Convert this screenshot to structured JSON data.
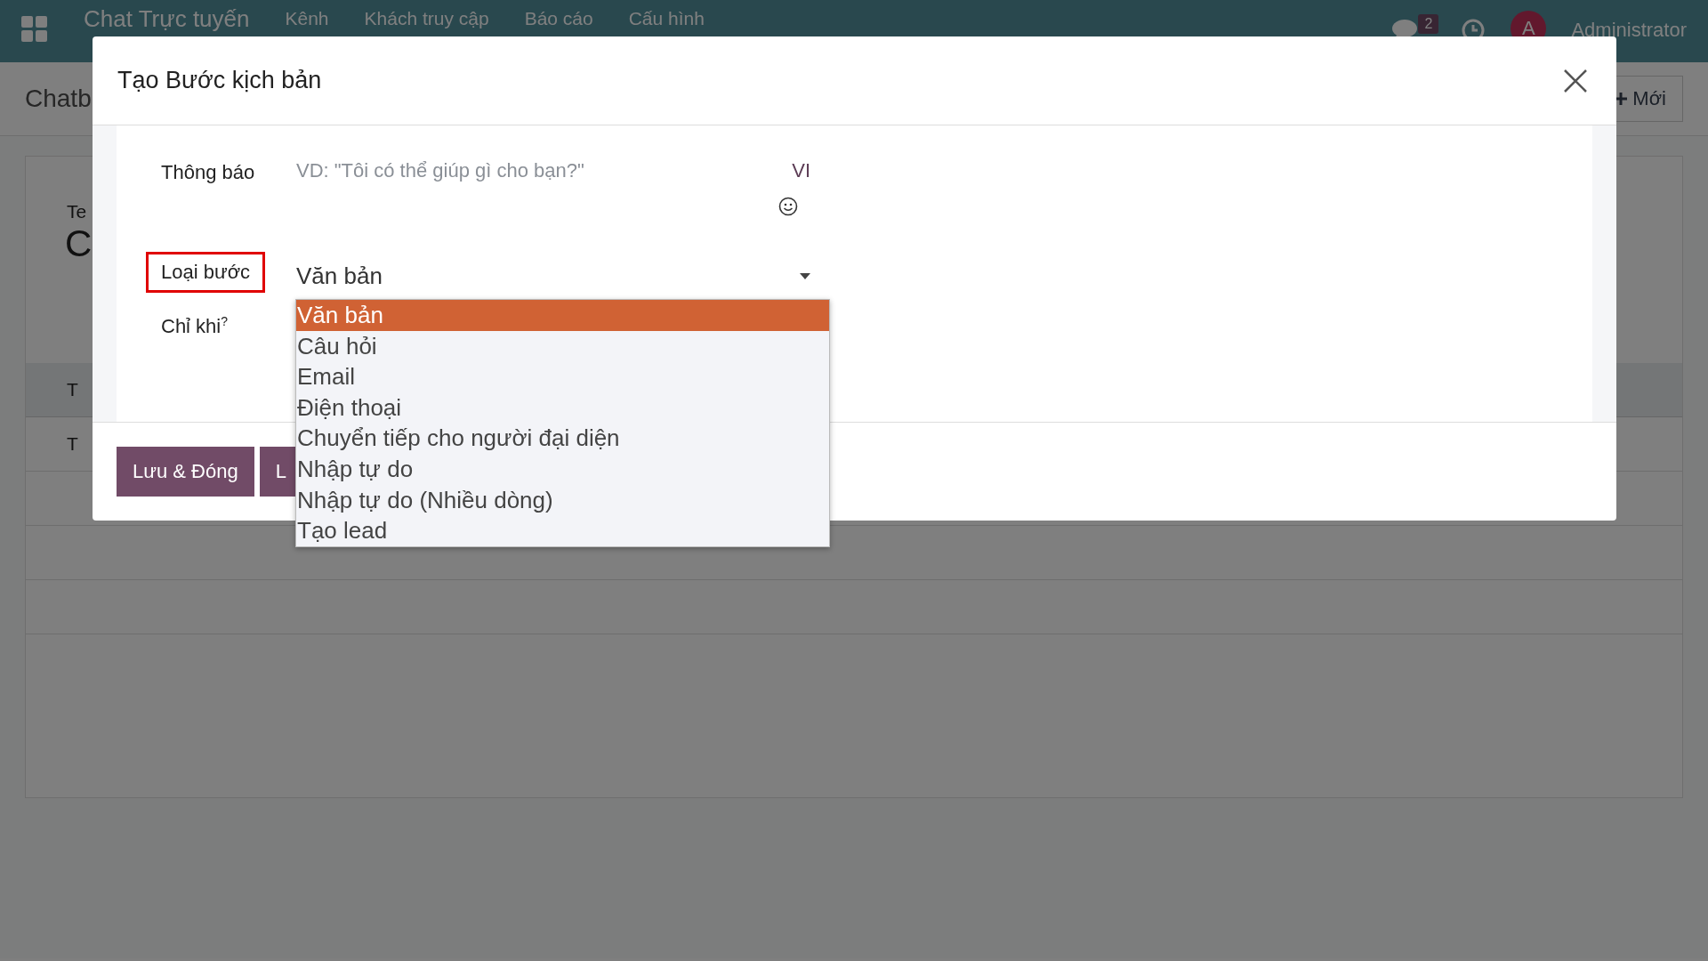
{
  "navbar": {
    "app_title": "Chat Trực tuyến",
    "menu": [
      "Kênh",
      "Khách truy cập",
      "Báo cáo",
      "Cấu hình"
    ],
    "message_badge": "2",
    "avatar_initial": "A",
    "user": "Administrator"
  },
  "page": {
    "breadcrumb": "Chatb",
    "new_button": "Mới",
    "field_label": "Te",
    "field_value": "C",
    "rows": [
      "T",
      "T"
    ]
  },
  "dialog": {
    "title": "Tạo Bước kịch bản",
    "fields": [
      {
        "kind": "text",
        "label": "Thông báo",
        "placeholder": "VD: \"Tôi có thể giúp gì cho bạn?\"",
        "lang": "VI",
        "highlighted": false
      },
      {
        "kind": "select",
        "label": "Loại bước",
        "value": "Văn bản",
        "highlighted": true
      },
      {
        "kind": "domain",
        "label": "Chỉ khi",
        "help": "?",
        "highlighted": false
      }
    ],
    "dropdown": [
      {
        "label": "Văn bản",
        "selected": true
      },
      {
        "label": "Câu hỏi",
        "selected": false
      },
      {
        "label": "Email",
        "selected": false
      },
      {
        "label": "Điện thoại",
        "selected": false
      },
      {
        "label": "Chuyển tiếp cho người đại diện",
        "selected": false
      },
      {
        "label": "Nhập tự do",
        "selected": false
      },
      {
        "label": "Nhập tự do (Nhiều dòng)",
        "selected": false
      },
      {
        "label": "Tạo lead",
        "selected": false
      }
    ],
    "buttons": [
      "Lưu & Đóng",
      "L"
    ]
  }
}
